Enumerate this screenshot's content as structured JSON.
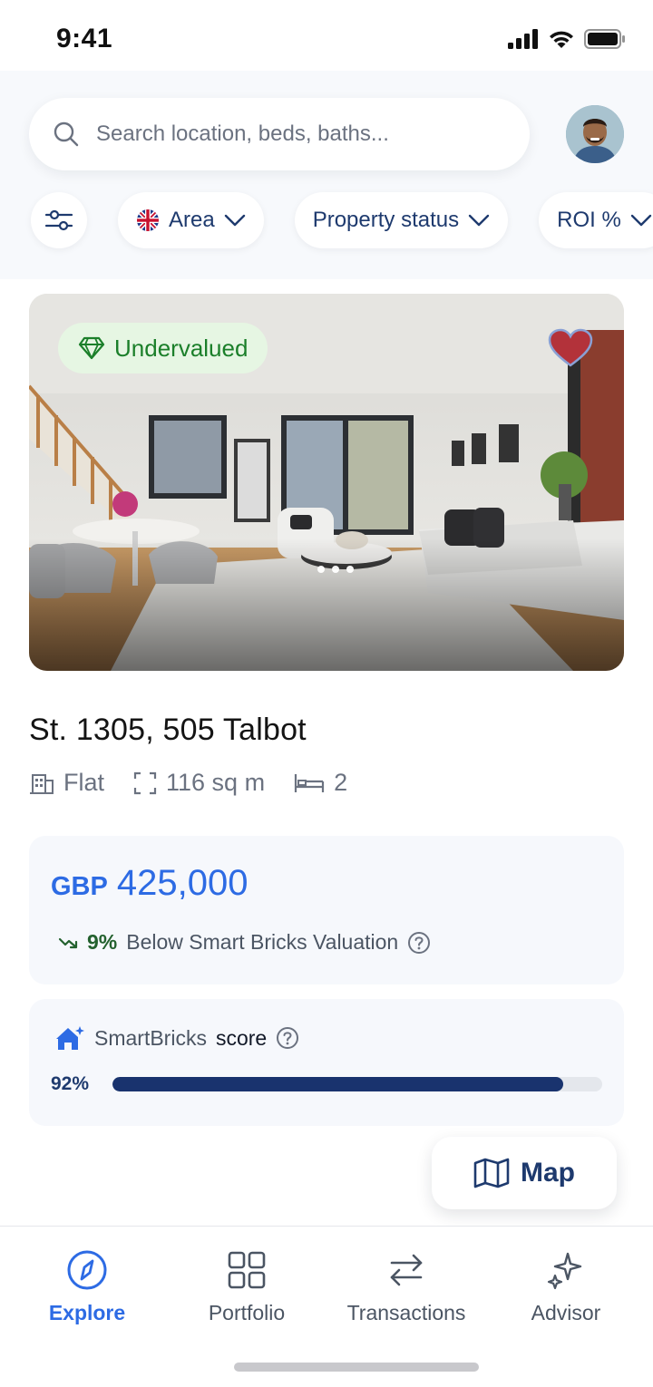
{
  "status_bar": {
    "time": "9:41"
  },
  "search": {
    "placeholder": "Search location, beds, baths..."
  },
  "filters": [
    {
      "label": "Area",
      "icon": "uk-flag-icon"
    },
    {
      "label": "Property status"
    },
    {
      "label": "ROI %"
    }
  ],
  "listing": {
    "badge": "Undervalued",
    "favorited": true,
    "title": "St. 1305, 505 Talbot",
    "type": "Flat",
    "area": "116 sq m",
    "bedrooms": "2",
    "currency": "GBP",
    "price": "425,000",
    "valuation_pct": "9%",
    "valuation_text": "Below Smart Bricks Valuation",
    "score_brand": "SmartBricks",
    "score_label": "score",
    "score_pct": "92%",
    "score_value": 0.92
  },
  "map_button": {
    "label": "Map"
  },
  "nav": [
    {
      "label": "Explore",
      "icon": "compass-icon",
      "active": true
    },
    {
      "label": "Portfolio",
      "icon": "grid-icon"
    },
    {
      "label": "Transactions",
      "icon": "swap-arrows-icon"
    },
    {
      "label": "Advisor",
      "icon": "sparkles-icon"
    }
  ],
  "colors": {
    "accent": "#2d6be4",
    "navy": "#1e3a6e",
    "badge_green": "#1b7f2a",
    "heart": "#b3323a"
  }
}
